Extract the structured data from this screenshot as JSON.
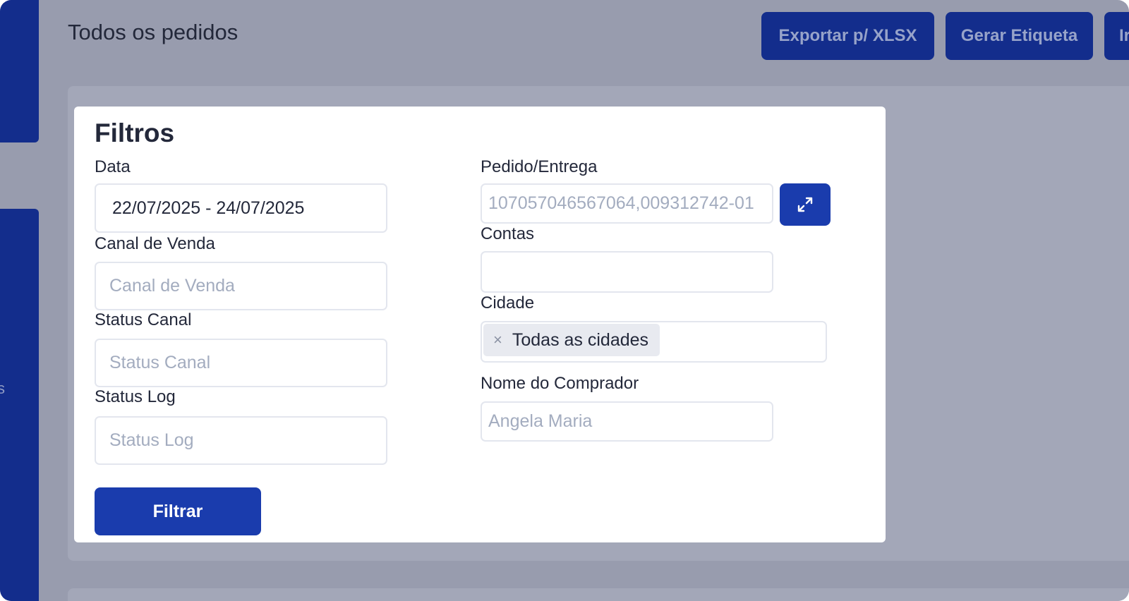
{
  "header": {
    "title": "Todos os pedidos",
    "buttons": {
      "export": "Exportar p/ XLSX",
      "label": "Gerar Etiqueta",
      "more": "Ir"
    }
  },
  "sidebar": {
    "edge_text": "s"
  },
  "filters": {
    "title": "Filtros",
    "data": {
      "label": "Data",
      "value": "22/07/2025 - 24/07/2025"
    },
    "canal_venda": {
      "label": "Canal de Venda",
      "placeholder": "Canal de Venda"
    },
    "status_canal": {
      "label": "Status Canal",
      "placeholder": "Status Canal"
    },
    "status_log": {
      "label": "Status Log",
      "placeholder": "Status Log"
    },
    "pedido_entrega": {
      "label": "Pedido/Entrega",
      "placeholder": "107057046567064,009312742-01"
    },
    "contas": {
      "label": "Contas",
      "value": ""
    },
    "cidade": {
      "label": "Cidade",
      "chip": "Todas as cidades",
      "chip_remove": "×"
    },
    "nome_comprador": {
      "label": "Nome do Comprador",
      "placeholder": "Angela Maria"
    },
    "submit": "Filtrar"
  },
  "colors": {
    "primary": "#1a3cad",
    "sidebar": "#132d8c",
    "overlay": "#989cae",
    "text": "#23283a",
    "placeholder": "#a3acbf"
  }
}
